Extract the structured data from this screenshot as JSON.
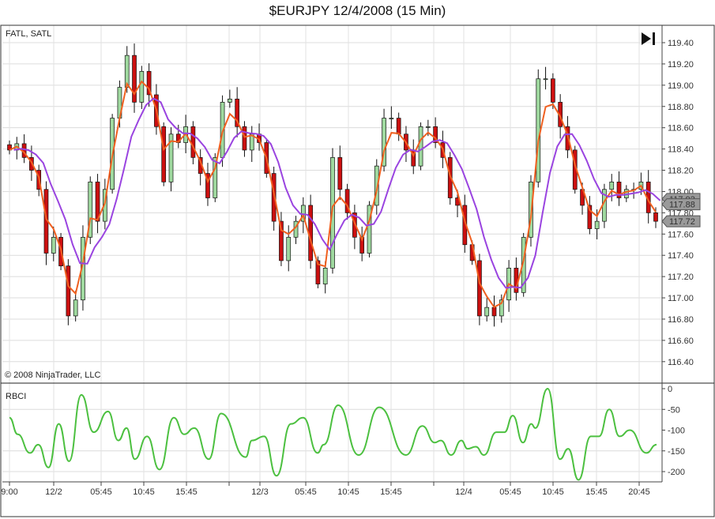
{
  "title": "$EURJPY  12/4/2008 (15 Min)",
  "chart_data": [
    {
      "type": "candlestick",
      "panel_label": "FATL, SATL",
      "copyright": "© 2008 NinjaTrader, LLC",
      "ylim": [
        116.3,
        119.5
      ],
      "y_ticks": [
        "119.40",
        "119.20",
        "119.00",
        "118.80",
        "118.60",
        "118.40",
        "118.20",
        "118.00",
        "117.80",
        "117.60",
        "117.40",
        "117.20",
        "117.00",
        "116.80",
        "116.60",
        "116.40"
      ],
      "grid": true,
      "closes": [
        118.39,
        118.45,
        118.32,
        118.2,
        118.02,
        117.42,
        117.57,
        117.3,
        116.83,
        116.98,
        117.57,
        118.09,
        117.72,
        118.02,
        118.69,
        118.98,
        119.28,
        118.84,
        119.13,
        118.91,
        118.61,
        118.09,
        118.54,
        118.46,
        118.61,
        118.32,
        118.17,
        117.94,
        118.32,
        118.84,
        118.87,
        118.61,
        118.39,
        118.54,
        118.46,
        118.17,
        117.72,
        117.35,
        117.57,
        117.72,
        117.87,
        117.35,
        117.13,
        117.28,
        118.32,
        118.02,
        117.8,
        117.57,
        117.42,
        117.87,
        118.24,
        118.69,
        118.69,
        118.54,
        118.39,
        118.24,
        118.61,
        118.61,
        118.46,
        118.32,
        117.94,
        117.87,
        117.5,
        117.35,
        116.83,
        116.91,
        116.83,
        116.98,
        117.28,
        117.05,
        117.57,
        118.09,
        119.06,
        119.06,
        118.84,
        118.61,
        118.39,
        118.02,
        117.87,
        117.65,
        117.72,
        118.02,
        118.09,
        117.94,
        118.02,
        118.02,
        118.09,
        117.8,
        117.72
      ],
      "series": [
        {
          "name": "FATL",
          "color": "#f06020"
        },
        {
          "name": "SATL",
          "color": "#9a44e0"
        }
      ],
      "price_markers": [
        "117.93",
        "117.88",
        "117.72"
      ],
      "up_color": "#9fd99f",
      "down_color": "#cc1010"
    },
    {
      "type": "line",
      "panel_label": "RBCI",
      "ylim": [
        -225,
        5
      ],
      "y_ticks": [
        "0",
        "-50",
        "-100",
        "-150",
        "-200"
      ],
      "color": "#4cc040",
      "points": [
        [
          0,
          -70
        ],
        [
          4,
          -110
        ],
        [
          10,
          -155
        ],
        [
          14,
          -135
        ],
        [
          19,
          -190
        ],
        [
          24,
          -85
        ],
        [
          29,
          -175
        ],
        [
          35,
          -15
        ],
        [
          41,
          -105
        ],
        [
          48,
          -55
        ],
        [
          53,
          -125
        ],
        [
          57,
          -95
        ],
        [
          61,
          -170
        ],
        [
          67,
          -115
        ],
        [
          73,
          -195
        ],
        [
          80,
          -70
        ],
        [
          85,
          -110
        ],
        [
          90,
          -95
        ],
        [
          97,
          -170
        ],
        [
          103,
          -60
        ],
        [
          115,
          -165
        ],
        [
          118,
          -125
        ],
        [
          124,
          -115
        ],
        [
          130,
          -210
        ],
        [
          137,
          -85
        ],
        [
          143,
          -70
        ],
        [
          150,
          -155
        ],
        [
          153,
          -135
        ],
        [
          160,
          -40
        ],
        [
          170,
          -160
        ],
        [
          180,
          -45
        ],
        [
          193,
          -160
        ],
        [
          201,
          -90
        ],
        [
          207,
          -130
        ],
        [
          210,
          -125
        ],
        [
          215,
          -160
        ],
        [
          220,
          -125
        ],
        [
          223,
          -145
        ],
        [
          227,
          -140
        ],
        [
          231,
          -160
        ],
        [
          237,
          -105
        ],
        [
          241,
          -105
        ],
        [
          245,
          -65
        ],
        [
          250,
          -130
        ],
        [
          254,
          -85
        ],
        [
          256,
          -95
        ],
        [
          262,
          0
        ],
        [
          268,
          -170
        ],
        [
          272,
          -145
        ],
        [
          277,
          -220
        ],
        [
          283,
          -115
        ],
        [
          287,
          -115
        ],
        [
          292,
          -50
        ],
        [
          297,
          -115
        ],
        [
          302,
          -100
        ],
        [
          310,
          -155
        ],
        [
          315,
          -135
        ]
      ]
    }
  ],
  "x_ticks": [
    "9:00",
    "12/2",
    "05:45",
    "10:45",
    "15:45",
    "12/3",
    "05:45",
    "10:45",
    "15:45",
    "12/4",
    "05:45",
    "10:45",
    "15:45",
    "20:45"
  ]
}
